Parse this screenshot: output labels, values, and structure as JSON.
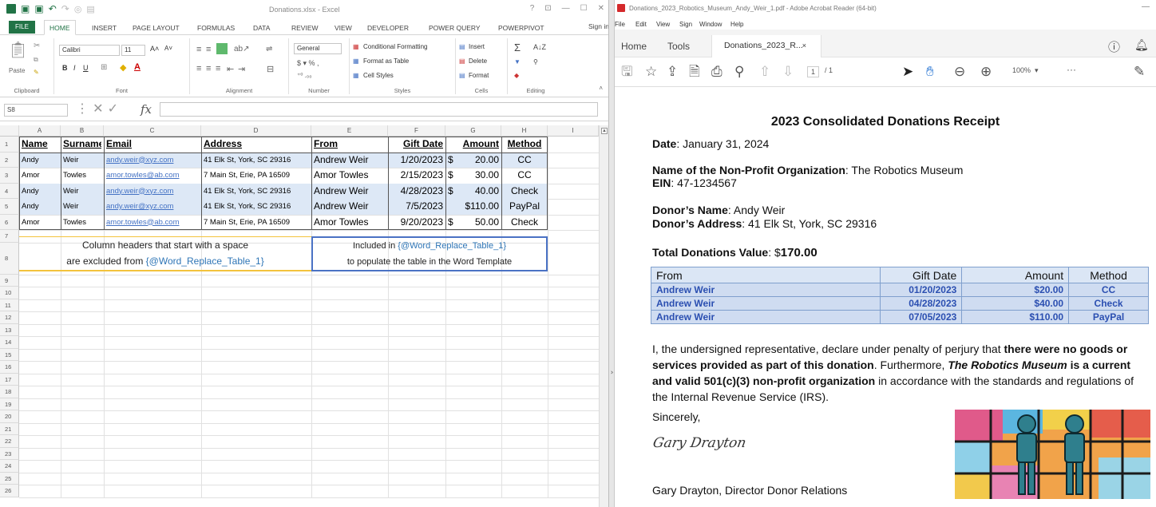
{
  "excel": {
    "title": "Donations.xlsx - Excel",
    "window_controls": [
      "?",
      "⊡",
      "—",
      "☐",
      "✕"
    ],
    "file_tab": "FILE",
    "tabs": [
      "HOME",
      "INSERT",
      "PAGE LAYOUT",
      "FORMULAS",
      "DATA",
      "REVIEW",
      "VIEW",
      "DEVELOPER",
      "POWER QUERY",
      "POWERPIVOT"
    ],
    "sign_in": "Sign in",
    "ribbon": {
      "clipboard": {
        "paste": "Paste",
        "label": "Clipboard"
      },
      "font": {
        "name": "Calibri",
        "size": "11",
        "label": "Font"
      },
      "alignment": {
        "label": "Alignment"
      },
      "number": {
        "format": "General",
        "label": "Number"
      },
      "styles": {
        "items": [
          "Conditional Formatting",
          "Format as Table",
          "Cell Styles"
        ],
        "label": "Styles"
      },
      "cells": {
        "items": [
          "Insert",
          "Delete",
          "Format"
        ],
        "label": "Cells"
      },
      "editing": {
        "label": "Editing"
      }
    },
    "name_box": "S8",
    "fx": "fx",
    "columns": [
      "A",
      "B",
      "C",
      "D",
      "E",
      "F",
      "G",
      "H",
      "I"
    ],
    "rows": [
      "1",
      "2",
      "3",
      "4",
      "5",
      "6",
      "7",
      "8",
      "9",
      "10",
      "11",
      "12",
      "13",
      "14",
      "15",
      "16",
      "17",
      "18",
      "19",
      "20",
      "21",
      "22",
      "23",
      "24",
      "25",
      "26"
    ],
    "headers": [
      "Name",
      "Surname",
      "Email",
      "Address",
      "From",
      "Gift Date",
      "Amount",
      "Method"
    ],
    "data": [
      [
        "Andy",
        "Weir",
        "andy.weir@xyz.com",
        "41 Elk St, York, SC 29316",
        "Andrew Weir",
        "1/20/2023",
        "$",
        "20.00",
        "CC"
      ],
      [
        "Amor",
        "Towles",
        "amor.towles@ab.com",
        "7 Main St, Erie, PA 16509",
        "Amor Towles",
        "2/15/2023",
        "$",
        "30.00",
        "CC"
      ],
      [
        "Andy",
        "Weir",
        "andy.weir@xyz.com",
        "41 Elk St, York, SC 29316",
        "Andrew Weir",
        "4/28/2023",
        "$",
        "40.00",
        "Check"
      ],
      [
        "Andy",
        "Weir",
        "andy.weir@xyz.com",
        "41 Elk St, York, SC 29316",
        "Andrew Weir",
        "7/5/2023",
        "$110.00",
        "",
        "PayPal"
      ],
      [
        "Amor",
        "Towles",
        "amor.towles@ab.com",
        "7 Main St, Erie, PA 16509",
        "Amor Towles",
        "9/20/2023",
        "$",
        "50.00",
        "Check"
      ]
    ],
    "note1": {
      "line1": "Column headers that start with a space",
      "line2_prefix": "are excluded from ",
      "token": "{@Word_Replace_Table_1}"
    },
    "note2": {
      "line1_prefix": "Included in ",
      "token": "{@Word_Replace_Table_1}",
      "line2": "to populate the table in the Word Template"
    }
  },
  "acrobat": {
    "title": "Donations_2023_Robotics_Museum_Andy_Weir_1.pdf - Adobe Acrobat Reader (64-bit)",
    "menu": [
      "File",
      "Edit",
      "View",
      "Sign",
      "Window",
      "Help"
    ],
    "tabs": {
      "home": "Home",
      "tools": "Tools",
      "doc": "Donations_2023_R...",
      "close": "×"
    },
    "page_current": "1",
    "page_total": "/ 1",
    "zoom": "100%",
    "more": "···"
  },
  "receipt": {
    "title": "2023 Consolidated Donations Receipt",
    "date_label": "Date",
    "date_value": ": January 31, 2024",
    "org_label": "Name of the Non-Profit Organization",
    "org_value": ": The Robotics Museum",
    "ein_label": "EIN",
    "ein_value": ": 47-1234567",
    "donor_label": "Donor’s Name",
    "donor_value": ": Andy Weir",
    "addr_label": "Donor’s Address",
    "addr_value": ": 41 Elk St, York, SC 29316",
    "total_label": "Total Donations Value",
    "total_prefix": ": $",
    "total_value": "170.00",
    "table_headers": [
      "From",
      "Gift Date",
      "Amount",
      "Method"
    ],
    "table_rows": [
      [
        "Andrew Weir",
        "01/20/2023",
        "$20.00",
        "CC"
      ],
      [
        "Andrew Weir",
        "04/28/2023",
        "$40.00",
        "Check"
      ],
      [
        "Andrew Weir",
        "07/05/2023",
        "$110.00",
        "PayPal"
      ]
    ],
    "para_1": "I, the undersigned representative, declare under penalty of perjury that ",
    "para_2": "there were no goods or services provided as part of this donation",
    "para_3": ". Furthermore, ",
    "para_4": "The Robotics Museum",
    "para_5": " is a current and valid 501(c)(3) non-profit organization",
    "para_6": " in accordance with the standards and regulations of the Internal Revenue Service (IRS).",
    "sincerely": "Sincerely,",
    "signature": "Gary Drayton",
    "signer": "Gary Drayton, Director Donor Relations"
  },
  "colors": {
    "excel_green": "#217346",
    "band_blue": "#dde8f6",
    "link_blue": "#4472c4",
    "acrobat_red": "#d4292b",
    "note_yellow": "#f3c33d",
    "note_blue": "#4a72c4"
  }
}
